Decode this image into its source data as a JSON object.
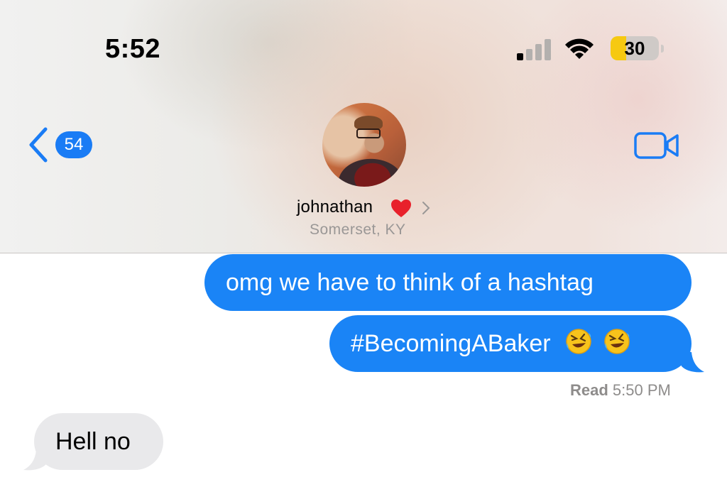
{
  "status_bar": {
    "time": "5:52",
    "battery_level": "30",
    "icons": [
      "cellular-signal-icon",
      "wifi-icon",
      "battery-icon"
    ]
  },
  "nav": {
    "back_badge_count": "54",
    "back_icon": "chevron-left-icon",
    "video_icon": "video-camera-icon",
    "accent_color": "#1a7cf5"
  },
  "contact": {
    "name": "johnathan",
    "emoji_icon": "red-heart-icon",
    "location": "Somerset, KY"
  },
  "messages": [
    {
      "direction": "sent",
      "text": "omg we have to think of a hashtag"
    },
    {
      "direction": "sent",
      "text": "#BecomingABaker",
      "emojis": [
        "rolling-on-floor-laughing-icon",
        "rolling-on-floor-laughing-icon"
      ]
    },
    {
      "direction": "received",
      "text": "Hell no"
    }
  ],
  "receipt": {
    "label": "Read",
    "time": "5:50 PM"
  },
  "colors": {
    "sent_bubble": "#1a84f6",
    "received_bubble": "#e9e9eb",
    "battery_fill": "#f6c911"
  }
}
